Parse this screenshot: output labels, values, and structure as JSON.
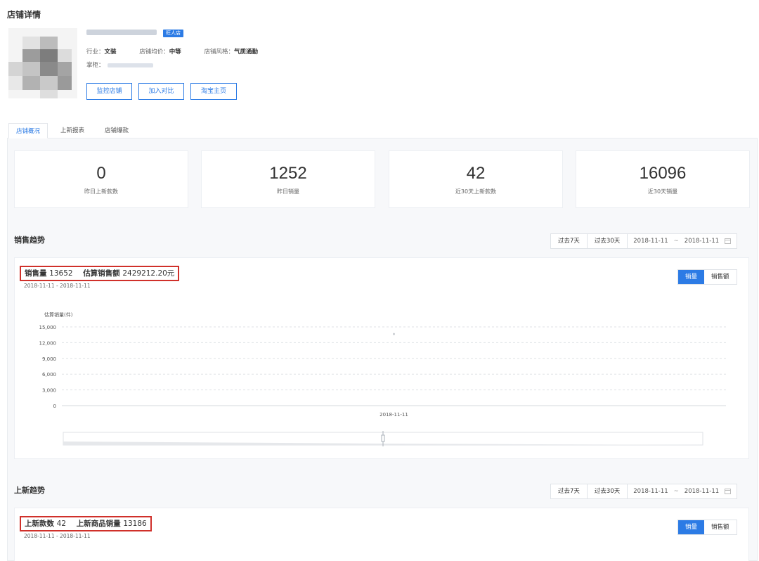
{
  "page": {
    "title": "店铺详情"
  },
  "shop": {
    "badge": "旺人店",
    "meta": [
      {
        "label": "行业：",
        "value": "文装"
      },
      {
        "label": "店铺均价：",
        "value": "中等"
      },
      {
        "label": "店铺风格：",
        "value": "气质通勤"
      }
    ],
    "owner_label": "掌柜："
  },
  "actions": {
    "monitor": "监控店铺",
    "compare": "加入对比",
    "taobao": "淘宝主页"
  },
  "tabs": [
    "店铺概况",
    "上新报表",
    "店铺爆款"
  ],
  "stats": [
    {
      "value": "0",
      "label": "昨日上新款数"
    },
    {
      "value": "1252",
      "label": "昨日销量"
    },
    {
      "value": "42",
      "label": "近30天上新款数"
    },
    {
      "value": "16096",
      "label": "近30天销量"
    }
  ],
  "sales_trend": {
    "title": "销售趋势",
    "range": {
      "last7": "过去7天",
      "last30": "过去30天",
      "start": "2018-11-11",
      "sep": "~",
      "end": "2018-11-11"
    },
    "summary_label1": "销售量",
    "summary_value1": "13652",
    "summary_label2": "估算销售额",
    "summary_value2": "2429212.20元",
    "date_range": "2018-11-11 - 2018-11-11",
    "toggle": {
      "volume": "销量",
      "amount": "销售额"
    }
  },
  "new_trend": {
    "title": "上新趋势",
    "range": {
      "last7": "过去7天",
      "last30": "过去30天",
      "start": "2018-11-11",
      "sep": "~",
      "end": "2018-11-11"
    },
    "summary_label1": "上新款数",
    "summary_value1": "42",
    "summary_label2": "上新商品销量",
    "summary_value2": "13186",
    "date_range": "2018-11-11 - 2018-11-11",
    "toggle": {
      "volume": "销量",
      "amount": "销售额"
    }
  },
  "colors": {
    "accent": "#2c7be5",
    "highlight": "#d0302a"
  },
  "chart_data": {
    "type": "line",
    "ylabel": "估算销量(件)",
    "y_ticks": [
      "15,000",
      "12,000",
      "9,000",
      "6,000",
      "3,000",
      "0"
    ],
    "ylim": [
      0,
      15000
    ],
    "x": [
      "2018-11-11"
    ],
    "series": [
      {
        "values": [
          13652
        ]
      }
    ],
    "grid": true
  }
}
